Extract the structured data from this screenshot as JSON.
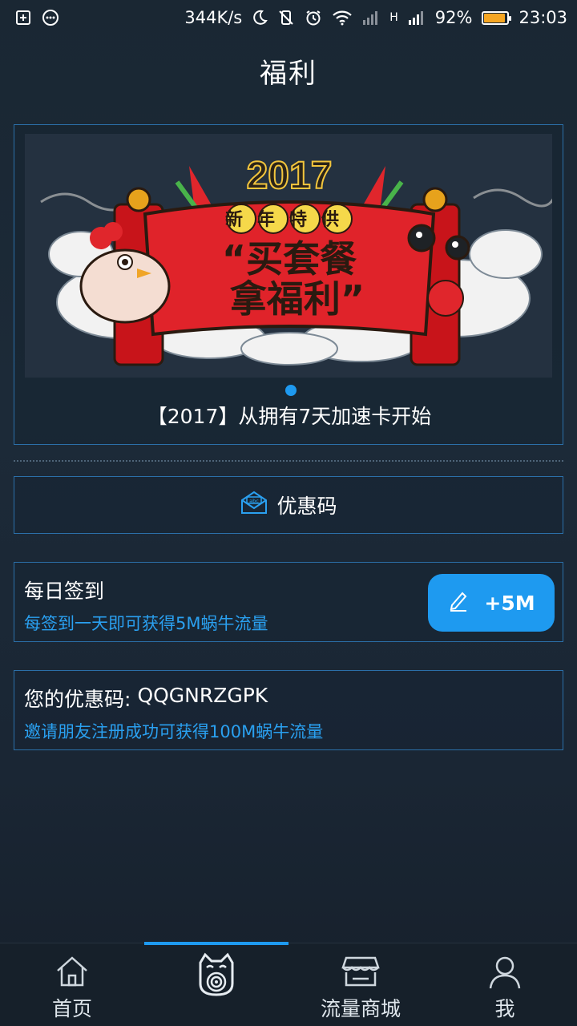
{
  "status_bar": {
    "net_speed": "344K/s",
    "network_type": "H",
    "battery_percent": "92%",
    "battery_level": 0.92,
    "time": "23:03"
  },
  "page": {
    "title": "福利"
  },
  "banner": {
    "image_text_year": "2017",
    "image_text_tag": "新年特供",
    "image_text_line1": "“买套餐",
    "image_text_line2": "拿福利”",
    "caption": "【2017】从拥有7天加速卡开始"
  },
  "coupon": {
    "label": "优惠码",
    "icon": "abc-envelope-icon"
  },
  "signin": {
    "title": "每日签到",
    "desc": "每签到一天即可获得5M蜗牛流量",
    "button_label": "+5M",
    "button_icon": "pen-icon"
  },
  "invite": {
    "label": "您的优惠码:",
    "code": "QQGNRZGPK",
    "desc": "邀请朋友注册成功可获得100M蜗牛流量"
  },
  "nav": {
    "items": [
      {
        "label": "首页",
        "icon": "home-icon"
      },
      {
        "label": "",
        "icon": "snail-cat-icon"
      },
      {
        "label": "流量商城",
        "icon": "store-icon"
      },
      {
        "label": "我",
        "icon": "user-icon"
      }
    ],
    "active_index": 1
  },
  "colors": {
    "accent": "#1e9af0",
    "card_border": "#2b6fa8",
    "link_text": "#2aa0f0",
    "battery": "#f5a623"
  }
}
